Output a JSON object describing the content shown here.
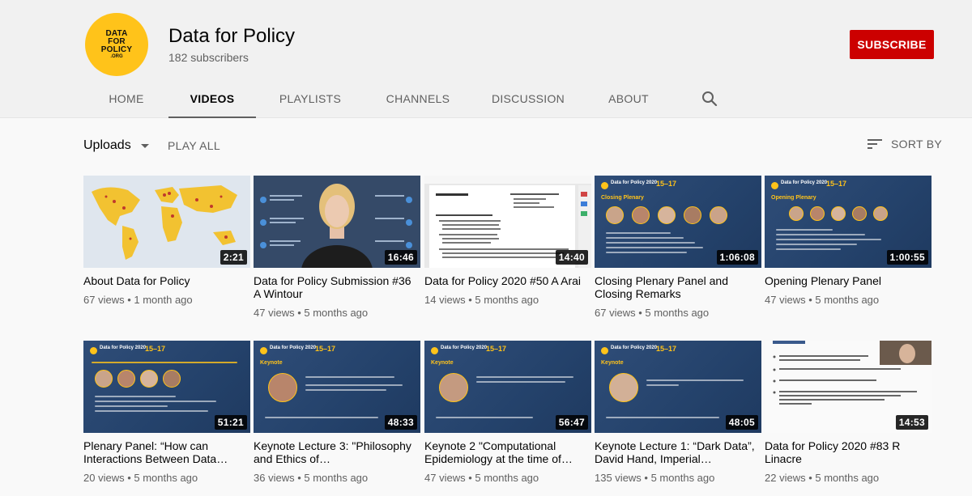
{
  "channel": {
    "name": "Data for Policy",
    "subscribers": "182 subscribers",
    "logo_lines": [
      "DATA",
      "FOR",
      "POLICY"
    ],
    "logo_suffix": ".ORG",
    "subscribe_label": "SUBSCRIBE"
  },
  "tabs": [
    {
      "label": "HOME",
      "active": false
    },
    {
      "label": "VIDEOS",
      "active": true
    },
    {
      "label": "PLAYLISTS",
      "active": false
    },
    {
      "label": "CHANNELS",
      "active": false
    },
    {
      "label": "DISCUSSION",
      "active": false
    },
    {
      "label": "ABOUT",
      "active": false
    }
  ],
  "toolbar": {
    "uploads_label": "Uploads",
    "play_all_label": "PLAY ALL",
    "sort_label": "SORT BY"
  },
  "videos": [
    {
      "title": "About Data for Policy",
      "views": "67 views",
      "age": "1 month ago",
      "duration": "2:21",
      "thumb": "map"
    },
    {
      "title": "Data for Policy Submission #36 A Wintour",
      "views": "47 views",
      "age": "5 months ago",
      "duration": "16:46",
      "thumb": "talk"
    },
    {
      "title": "Data for Policy 2020 #50 A Arai",
      "views": "14 views",
      "age": "5 months ago",
      "duration": "14:40",
      "thumb": "doc"
    },
    {
      "title": "Closing Plenary Panel and Closing Remarks",
      "views": "67 views",
      "age": "5 months ago",
      "duration": "1:06:08",
      "thumb": "slide-panel",
      "tag": "Closing Plenary"
    },
    {
      "title": "Opening Plenary Panel",
      "views": "47 views",
      "age": "5 months ago",
      "duration": "1:00:55",
      "thumb": "slide-panel",
      "tag": "Opening Plenary"
    },
    {
      "title": "Plenary Panel: “How can Interactions Between Data…",
      "views": "20 views",
      "age": "5 months ago",
      "duration": "51:21",
      "thumb": "slide-panel2"
    },
    {
      "title": "Keynote Lecture 3: \"Philosophy and Ethics of…",
      "views": "36 views",
      "age": "5 months ago",
      "duration": "48:33",
      "thumb": "slide-keynote",
      "tag": "Keynote"
    },
    {
      "title": "Keynote 2 \"Computational Epidemiology at the time of…",
      "views": "47 views",
      "age": "5 months ago",
      "duration": "56:47",
      "thumb": "slide-keynote",
      "tag": "Keynote"
    },
    {
      "title": "Keynote Lecture 1: “Dark Data”, David Hand, Imperial…",
      "views": "135 views",
      "age": "5 months ago",
      "duration": "48:05",
      "thumb": "slide-keynote",
      "tag": "Keynote"
    },
    {
      "title": "Data for Policy 2020 #83 R Linacre",
      "views": "22 views",
      "age": "5 months ago",
      "duration": "14:53",
      "thumb": "white"
    }
  ],
  "slide_text": {
    "event": "Data for Policy 2020",
    "dates": "15–17"
  },
  "colors": {
    "brand_yellow": "#ffc31a",
    "subscribe_red": "#cc0000",
    "slide_blue": "#2f4d78"
  }
}
